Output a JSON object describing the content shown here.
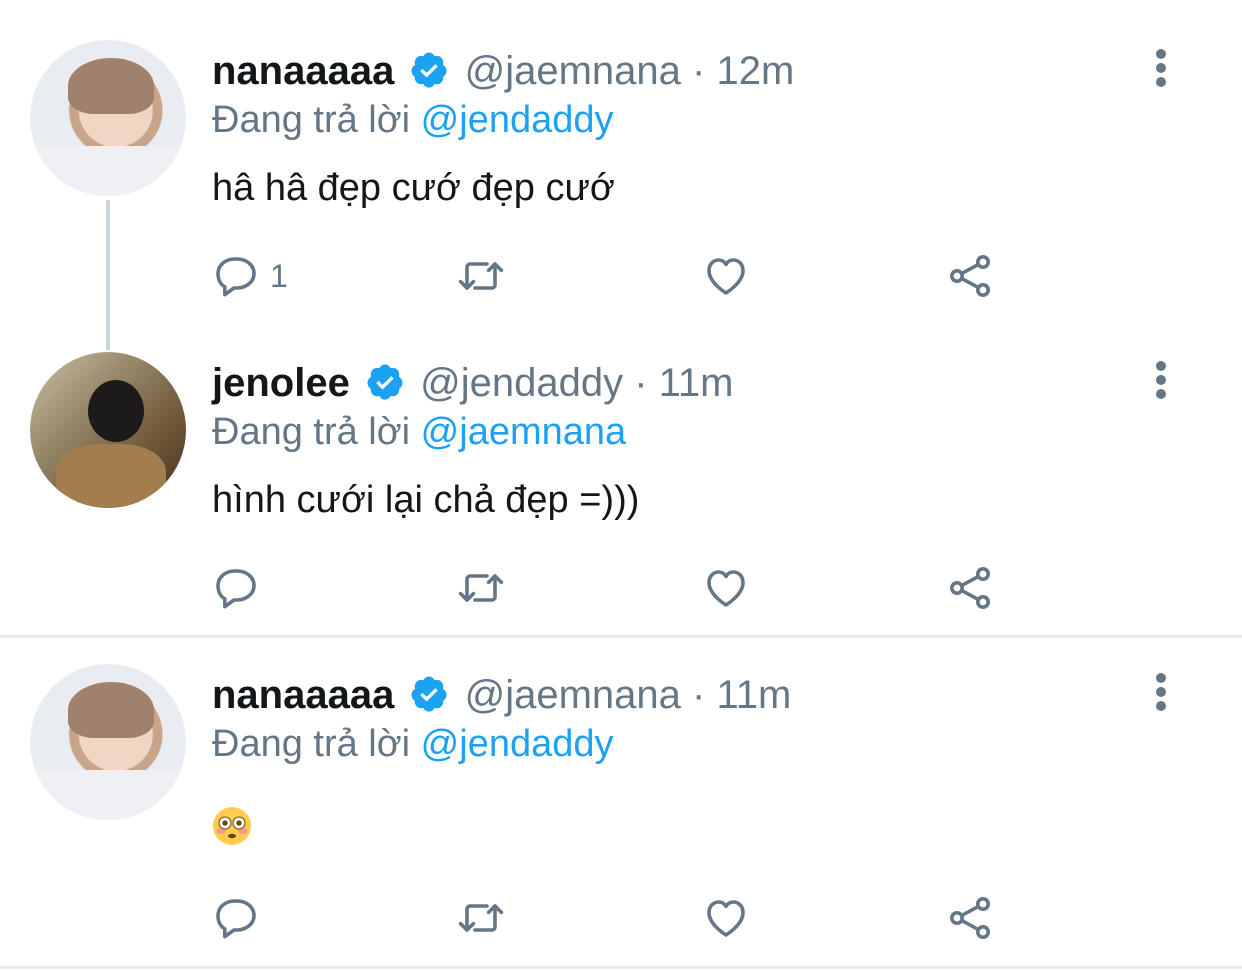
{
  "tweets": [
    {
      "name": "nanaaaaa",
      "handle": "@jaemnana",
      "sep": "·",
      "time": "12m",
      "replying_prefix": "Đang trả lời",
      "replying_to": "@jendaddy",
      "text": "hâ hâ đẹp cướ đẹp cướ",
      "reply_count": "1"
    },
    {
      "name": "jenolee",
      "handle": "@jendaddy",
      "sep": "·",
      "time": "11m",
      "replying_prefix": "Đang trả lời",
      "replying_to": "@jaemnana",
      "text": "hình cưới lại chả đẹp =)))",
      "reply_count": ""
    },
    {
      "name": "nanaaaaa",
      "handle": "@jaemnana",
      "sep": "·",
      "time": "11m",
      "replying_prefix": "Đang trả lời",
      "replying_to": "@jendaddy",
      "text": "",
      "reply_count": ""
    }
  ],
  "icons": {
    "reply": "reply-icon",
    "retweet": "retweet-icon",
    "like": "like-icon",
    "share": "share-icon",
    "more": "more-vertical-icon",
    "verified": "verified-badge-icon",
    "emoji": "flushed-face-emoji"
  },
  "colors": {
    "accent": "#1da1f2",
    "secondary_text": "#657786",
    "icon": "#657786",
    "divider": "#e6ecf0"
  }
}
